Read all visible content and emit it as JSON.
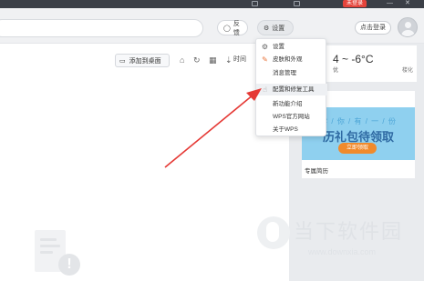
{
  "titlebar": {
    "item_left": "",
    "item_mid": "",
    "badge": "未登录",
    "controls": [
      "—",
      "✕"
    ]
  },
  "toolbar": {
    "feedback_label": "反馈",
    "settings_label": "设置",
    "login_label": "点击登录"
  },
  "main": {
    "add_desktop_label": "添加到桌面",
    "time_label": "时间"
  },
  "menu": {
    "items": [
      {
        "label": "设置",
        "icon": "gear-icon"
      },
      {
        "label": "皮肤和外观",
        "icon": "brush-icon"
      },
      {
        "label": "消息管理",
        "icon": ""
      },
      {
        "label": "配置和修复工具",
        "icon": "hand-cursor-icon"
      },
      {
        "label": "新功能介绍",
        "icon": ""
      },
      {
        "label": "WPS官方网站",
        "icon": ""
      },
      {
        "label": "关于WPS",
        "icon": ""
      }
    ]
  },
  "weather": {
    "temperature": "4 ~ -6°C",
    "condition": "优",
    "location": "楼化"
  },
  "promo": {
    "line1": "学 / 你 / 有 / 一 / 份",
    "line2": "历礼包待领取",
    "button": "立即领取",
    "caption": "专属简历"
  },
  "watermark": {
    "text": "当下软件园",
    "url": "www.downxia.com"
  },
  "colors": {
    "accent_red": "#e5443b",
    "arrow_red": "#e53935",
    "banner_blue": "#8fd0ef",
    "promo_orange": "#f08a2c"
  }
}
